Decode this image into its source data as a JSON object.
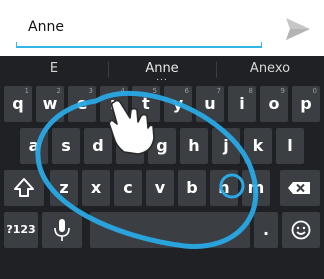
{
  "compose": {
    "text_value": "Anne",
    "send_icon": "send-icon"
  },
  "suggestions": [
    "E",
    "Anne",
    "Anexo"
  ],
  "suggestion_more": "...",
  "keyboard": {
    "row1": [
      {
        "label": "q",
        "hint": "1"
      },
      {
        "label": "w",
        "hint": "2"
      },
      {
        "label": "e",
        "hint": "3"
      },
      {
        "label": "r",
        "hint": "4"
      },
      {
        "label": "t",
        "hint": "5"
      },
      {
        "label": "y",
        "hint": "6"
      },
      {
        "label": "u",
        "hint": "7"
      },
      {
        "label": "i",
        "hint": "8"
      },
      {
        "label": "o",
        "hint": "9"
      },
      {
        "label": "p",
        "hint": "0"
      }
    ],
    "row2": [
      "a",
      "s",
      "d",
      "f",
      "g",
      "h",
      "j",
      "k",
      "l"
    ],
    "row3": [
      "z",
      "x",
      "c",
      "v",
      "b",
      "n",
      "m"
    ],
    "symbols_label": "?123",
    "period_label": ".",
    "shift_icon": "shift-icon",
    "backspace_icon": "backspace-icon",
    "mic_icon": "microphone-icon",
    "emoji_icon": "smiley-icon"
  },
  "colors": {
    "accent": "#33b5e5",
    "gesture_trail": "#29a9e6",
    "keyboard_bg": "#1f2124",
    "key_bg": "#3b3e42"
  }
}
